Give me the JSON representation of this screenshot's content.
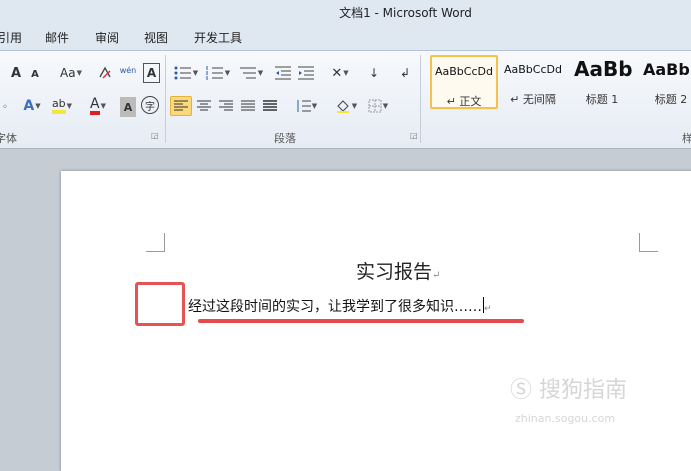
{
  "window": {
    "title": "文档1 - Microsoft Word"
  },
  "tabs": [
    "引用",
    "邮件",
    "审阅",
    "视图",
    "开发工具"
  ],
  "groups": {
    "font": "字体",
    "paragraph": "段落",
    "styles": "样"
  },
  "font_buttons": {
    "increase": "A",
    "decrease": "A",
    "case": "Aa",
    "phonetic": "wén",
    "clear": "A",
    "effects": "A",
    "highlight": "ab",
    "color": "A",
    "shade": "A",
    "enclose": "字"
  },
  "styles": [
    {
      "sample": "AaBbCcDd",
      "name": "↵ 正文"
    },
    {
      "sample": "AaBbCcDd",
      "name": "↵ 无间隔"
    },
    {
      "sample": "AaBb",
      "name": "标题 1"
    },
    {
      "sample": "AaBb",
      "name": "标题 2"
    }
  ],
  "document": {
    "heading": "实习报告",
    "body": "经过这段时间的实习，让我学到了很多知识……",
    "paragraph_mark": "↵"
  },
  "watermark": {
    "text": "搜狗指南",
    "url": "zhinan.sogou.com"
  },
  "colors": {
    "highlight": "#f5e63c",
    "font_color": "#e02020",
    "annotation": "#e55454"
  }
}
